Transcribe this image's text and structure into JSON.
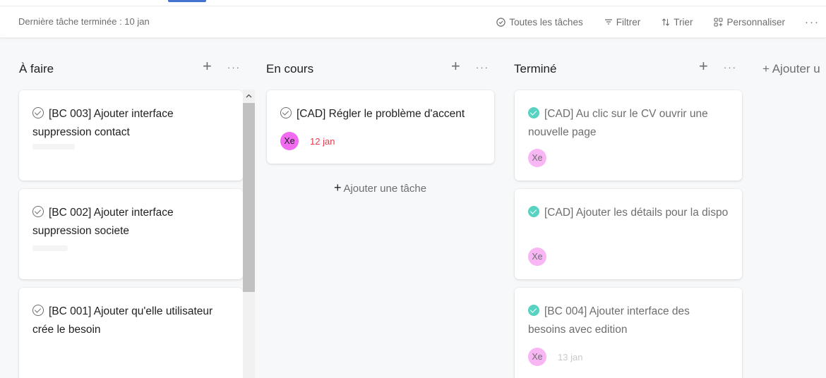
{
  "toolbar": {
    "last_task": "Dernière tâche terminée : 10 jan",
    "all_tasks": "Toutes les tâches",
    "filter": "Filtrer",
    "sort": "Trier",
    "customize": "Personnaliser",
    "more": "···",
    "icons": {
      "all_tasks": "check-circle-icon",
      "filter": "filter-icon",
      "sort": "sort-icon",
      "customize": "customize-icon"
    }
  },
  "columns": [
    {
      "title": "À faire",
      "add": "+",
      "more": "···",
      "cards": [
        {
          "title": "[BC 003] Ajouter interface suppression contact"
        },
        {
          "title": "[BC 002] Ajouter interface suppression societe"
        },
        {
          "title": "[BC 001] Ajouter qu'elle utilisateur crée le besoin"
        }
      ]
    },
    {
      "title": "En cours",
      "add": "+",
      "more": "···",
      "cards": [
        {
          "title": "[CAD] Régler le problème d'accent",
          "assignee": "Xe",
          "due": "12 jan"
        }
      ],
      "add_task_label": "Ajouter une tâche",
      "add_task_plus": "+"
    },
    {
      "title": "Terminé",
      "add": "+",
      "more": "···",
      "cards": [
        {
          "title": "[CAD] Au clic sur le CV ouvrir une nouvelle page",
          "assignee": "Xe"
        },
        {
          "title": "[CAD] Ajouter les détails pour la dispo",
          "assignee": "Xe"
        },
        {
          "title": "[BC 004] Ajouter interface des besoins avec edition",
          "assignee": "Xe",
          "due": "13 jan"
        }
      ]
    }
  ],
  "add_section": "+ Ajouter u",
  "colors": {
    "accent": "#4573d2",
    "complete": "#58d3c1",
    "avatar": "#f06bf0",
    "due_overdue": "#e8384f"
  }
}
